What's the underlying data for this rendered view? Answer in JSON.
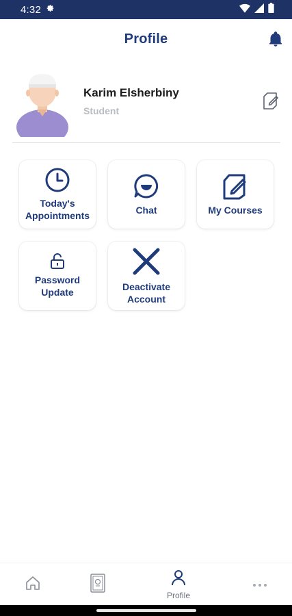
{
  "status_bar": {
    "time": "4:32",
    "icons": [
      "gear-icon",
      "wifi-icon",
      "signal-icon",
      "battery-icon"
    ]
  },
  "header": {
    "title": "Profile",
    "notification_icon": "bell-icon"
  },
  "profile": {
    "name": "Karim Elsherbiny",
    "role": "Student",
    "edit_icon": "edit-icon"
  },
  "tiles": [
    {
      "id": "appointments",
      "label_line1": "Today's",
      "label_line2": "Appointments",
      "icon": "clock-icon"
    },
    {
      "id": "chat",
      "label_line1": "Chat",
      "label_line2": "",
      "icon": "chat-icon"
    },
    {
      "id": "courses",
      "label_line1": "My Courses",
      "label_line2": "",
      "icon": "note-edit-icon"
    },
    {
      "id": "password",
      "label_line1": "Password",
      "label_line2": "Update",
      "icon": "lock-icon"
    },
    {
      "id": "deactivate",
      "label_line1": "Deactivate",
      "label_line2": "Account",
      "icon": "close-icon"
    }
  ],
  "bottom_nav": {
    "items": [
      {
        "id": "home",
        "label": "",
        "icon": "home-icon"
      },
      {
        "id": "book",
        "label": "",
        "icon": "book-icon"
      },
      {
        "id": "profile",
        "label": "Profile",
        "icon": "person-icon"
      },
      {
        "id": "more",
        "label": "",
        "icon": "more-icon"
      }
    ]
  },
  "colors": {
    "primary": "#1f3b7a",
    "status_bar": "#1f3266",
    "avatar_shirt": "#9b8dd0",
    "muted": "#b9bcc3"
  }
}
